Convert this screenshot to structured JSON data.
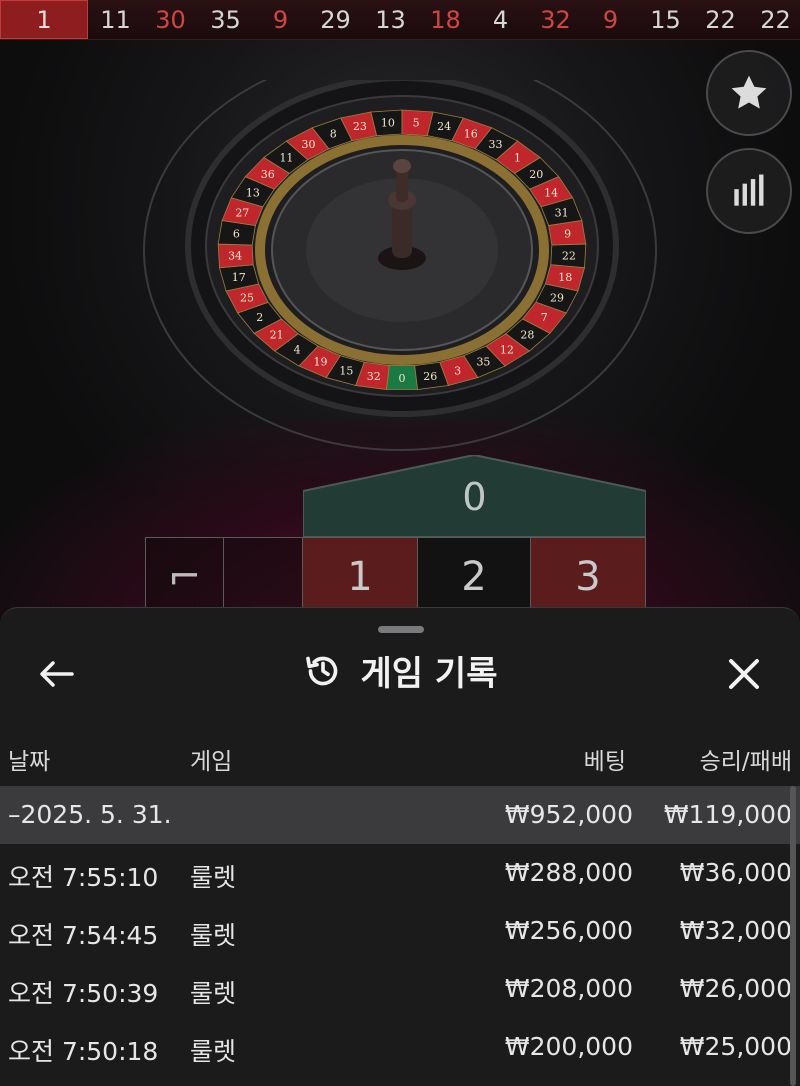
{
  "history_strip": {
    "numbers": [
      {
        "value": "1",
        "color": "red",
        "highlight": true
      },
      {
        "value": "11",
        "color": "black"
      },
      {
        "value": "30",
        "color": "red"
      },
      {
        "value": "35",
        "color": "black"
      },
      {
        "value": "9",
        "color": "red"
      },
      {
        "value": "29",
        "color": "black"
      },
      {
        "value": "13",
        "color": "black"
      },
      {
        "value": "18",
        "color": "red"
      },
      {
        "value": "4",
        "color": "black"
      },
      {
        "value": "32",
        "color": "red"
      },
      {
        "value": "9",
        "color": "red"
      },
      {
        "value": "15",
        "color": "black"
      },
      {
        "value": "22",
        "color": "black"
      },
      {
        "value": "22",
        "color": "black"
      }
    ]
  },
  "wheel": {
    "pockets": [
      "0",
      "32",
      "15",
      "19",
      "4",
      "21",
      "2",
      "25",
      "17",
      "34",
      "6",
      "27",
      "13",
      "36",
      "11",
      "30",
      "8",
      "23",
      "10",
      "5",
      "24",
      "16",
      "33",
      "1",
      "20",
      "14",
      "31",
      "9",
      "22",
      "18",
      "29",
      "7",
      "28",
      "12",
      "35",
      "3",
      "26"
    ]
  },
  "side_buttons": {
    "favorite_icon": "star-icon",
    "stats_icon": "bar-chart-icon"
  },
  "board": {
    "zero": "0",
    "cells": [
      "1",
      "2",
      "3"
    ],
    "left_cell_glyph": "⌐"
  },
  "sheet": {
    "title": "게임 기록",
    "title_icon": "history-icon",
    "back_icon": "arrow-left-icon",
    "close_icon": "close-icon",
    "columns": {
      "date": "날짜",
      "game": "게임",
      "bet": "베팅",
      "win_loss": "승리/패배"
    },
    "date_row": {
      "date": "–2025. 5. 31.",
      "bet": "₩952,000",
      "win_loss": "₩119,000"
    },
    "rows": [
      {
        "time": "오전 7:55:10",
        "game": "룰렛",
        "bet": "₩288,000",
        "win_loss": "₩36,000"
      },
      {
        "time": "오전 7:54:45",
        "game": "룰렛",
        "bet": "₩256,000",
        "win_loss": "₩32,000"
      },
      {
        "time": "오전 7:50:39",
        "game": "룰렛",
        "bet": "₩208,000",
        "win_loss": "₩26,000"
      },
      {
        "time": "오전 7:50:18",
        "game": "룰렛",
        "bet": "₩200,000",
        "win_loss": "₩25,000"
      }
    ]
  },
  "colors": {
    "red": "#c0272d",
    "green": "#1b7a44",
    "black": "#161616",
    "zero_green_board": "#233b35"
  }
}
